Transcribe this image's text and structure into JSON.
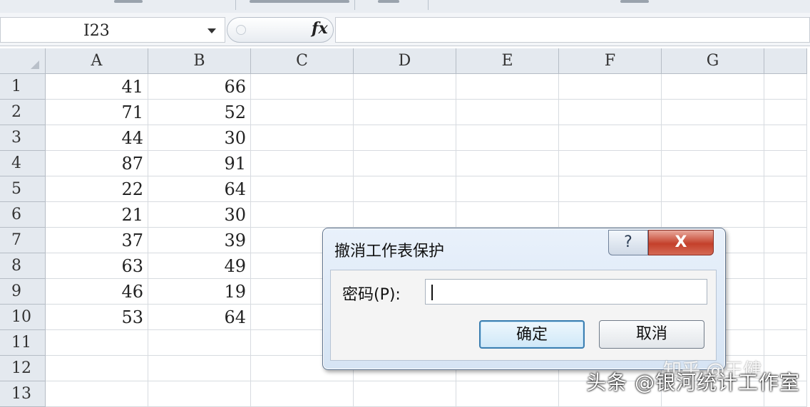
{
  "formula_bar": {
    "name_box_value": "I23",
    "fx_label": "fx"
  },
  "columns": [
    "A",
    "B",
    "C",
    "D",
    "E",
    "F",
    "G"
  ],
  "rows": [
    {
      "num": "1",
      "A": "41",
      "B": "66"
    },
    {
      "num": "2",
      "A": "71",
      "B": "52"
    },
    {
      "num": "3",
      "A": "44",
      "B": "30"
    },
    {
      "num": "4",
      "A": "87",
      "B": "91"
    },
    {
      "num": "5",
      "A": "22",
      "B": "64"
    },
    {
      "num": "6",
      "A": "21",
      "B": "30"
    },
    {
      "num": "7",
      "A": "37",
      "B": "39"
    },
    {
      "num": "8",
      "A": "63",
      "B": "49"
    },
    {
      "num": "9",
      "A": "46",
      "B": "19"
    },
    {
      "num": "10",
      "A": "53",
      "B": "64"
    },
    {
      "num": "11",
      "A": "",
      "B": ""
    },
    {
      "num": "12",
      "A": "",
      "B": ""
    },
    {
      "num": "13",
      "A": "",
      "B": ""
    }
  ],
  "dialog": {
    "title": "撤消工作表保护",
    "help_label": "?",
    "close_label": "X",
    "password_label": "密码(P):",
    "password_value": "",
    "ok_label": "确定",
    "cancel_label": "取消"
  },
  "watermark": {
    "main": "头条 @银河统计工作室",
    "faint": "知乎 @王健"
  },
  "colors": {
    "header_bg": "#e4e9ef",
    "grid_line": "#d7dbe0",
    "close_red": "#c4402b",
    "ok_focus": "#3c7fb1"
  }
}
